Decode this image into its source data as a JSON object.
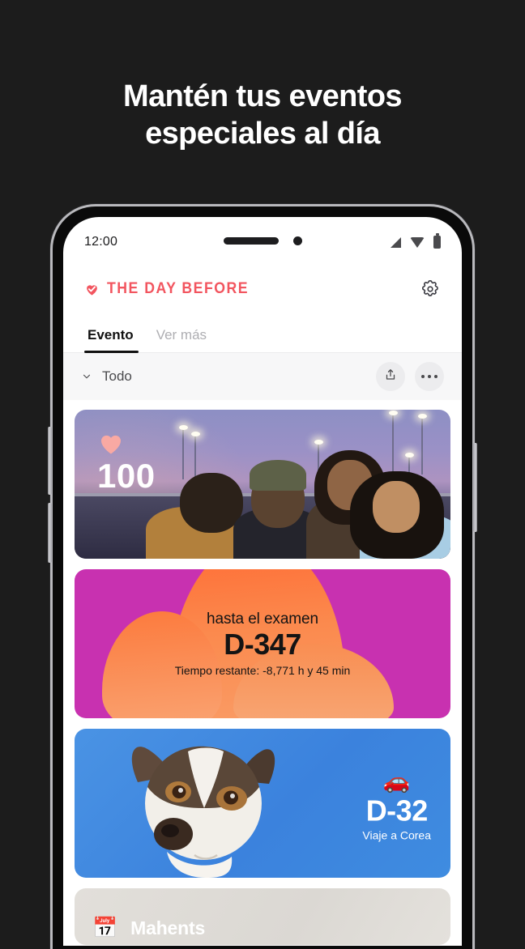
{
  "headline": {
    "line1": "Mantén tus eventos",
    "line2": "especiales al día"
  },
  "phone": {
    "status_bar": {
      "time": "12:00",
      "icons": [
        "signal-icon",
        "wifi-icon",
        "battery-icon"
      ]
    },
    "app_header": {
      "brand": "THE DAY BEFORE",
      "brand_color": "#f2555f",
      "logo_icon": "heart-check-icon",
      "settings_icon": "gear-icon"
    },
    "tabs": [
      {
        "label": "Evento",
        "active": true
      },
      {
        "label": "Ver más",
        "active": false
      }
    ],
    "filter_bar": {
      "chevron_icon": "chevron-down-icon",
      "label": "Todo",
      "share_icon": "share-icon",
      "more_icon": "more-dots-icon"
    },
    "cards": [
      {
        "type": "photo-count",
        "badge_icon": "heart-icon",
        "badge_color": "#f9a9a3",
        "count": "100"
      },
      {
        "type": "exam-countdown",
        "subtitle": "hasta el examen",
        "countdown": "D-347",
        "remaining": "Tiempo restante: -8,771 h y 45 min",
        "bg_color": "#c831b0",
        "accent_color": "#ff6a33"
      },
      {
        "type": "trip-countdown",
        "emoji": "🚗",
        "countdown": "D-32",
        "title": "Viaje a Corea",
        "bg_color": "#3d8fe0"
      },
      {
        "type": "plain",
        "emoji": "📅",
        "title": "Mahents",
        "bg_color": "#dfdcd7"
      }
    ]
  }
}
